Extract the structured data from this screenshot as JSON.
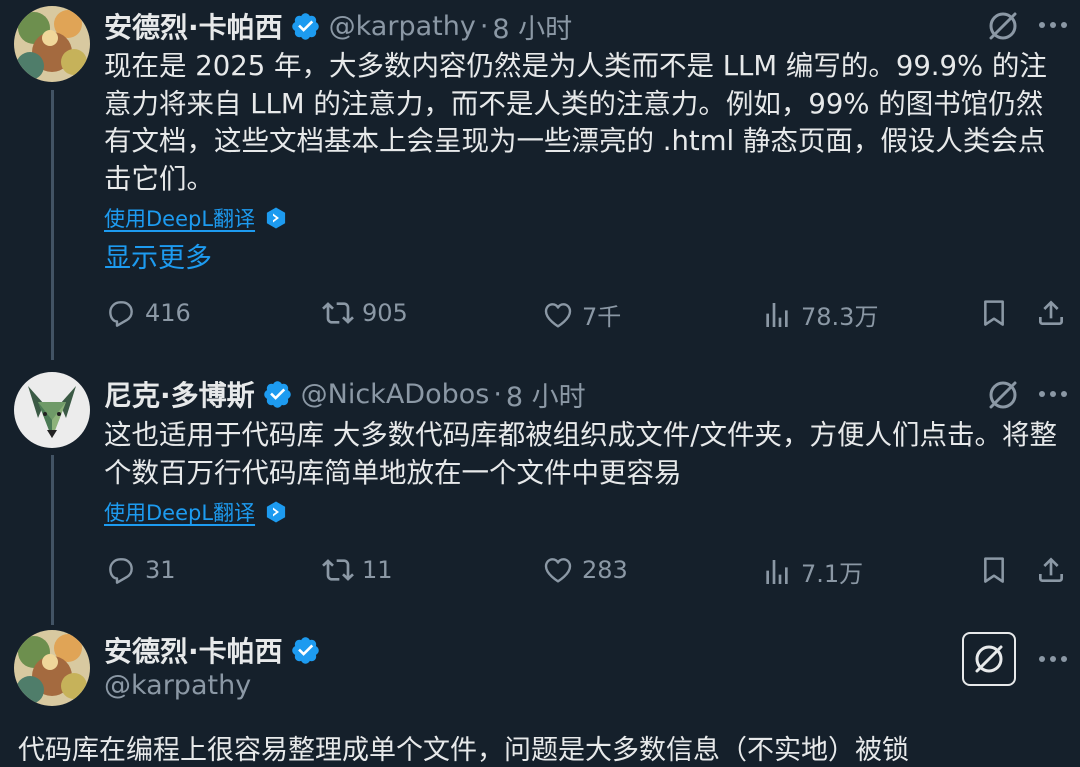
{
  "posts": [
    {
      "name": "安德烈·卡帕西",
      "handle": "@karpathy",
      "separator": "·",
      "time": "8 小时",
      "text": "现在是 2025 年，大多数内容仍然是为人类而不是 LLM 编写的。99.9% 的注意力将来自 LLM 的注意力，而不是人类的注意力。例如，99% 的图书馆仍然有文档，这些文档基本上会呈现为一些漂亮的 .html 静态页面，假设人类会点击它们。",
      "translate_label": "使用DeepL翻译",
      "show_more": "显示更多",
      "stats": {
        "replies": "416",
        "reposts": "905",
        "likes": "7千",
        "views": "78.3万"
      }
    },
    {
      "name": "尼克·多博斯",
      "handle": "@NickADobos",
      "separator": "·",
      "time": "8 小时",
      "text": "这也适用于代码库 大多数代码库都被组织成文件/文件夹，方便人们点击。将整个数百万行代码库简单地放在一个文件中更容易",
      "translate_label": "使用DeepL翻译",
      "stats": {
        "replies": "31",
        "reposts": "11",
        "likes": "283",
        "views": "7.1万"
      }
    },
    {
      "name": "安德烈·卡帕西",
      "handle": "@karpathy",
      "text_partial": "代码库在编程上很容易整理成单个文件，问题是大多数信息（不实地）被锁"
    }
  ],
  "icons": {
    "verified": "verified-badge-icon",
    "grok": "grok-icon",
    "more": "more-icon",
    "reply": "reply-icon",
    "repost": "repost-icon",
    "like": "like-icon",
    "views": "views-icon",
    "bookmark": "bookmark-icon",
    "share": "share-icon",
    "translate": "deepl-icon"
  },
  "colors": {
    "background": "#15202b",
    "accent": "#1d9bf0",
    "muted": "#8b98a5",
    "text": "#e7e9ea"
  }
}
